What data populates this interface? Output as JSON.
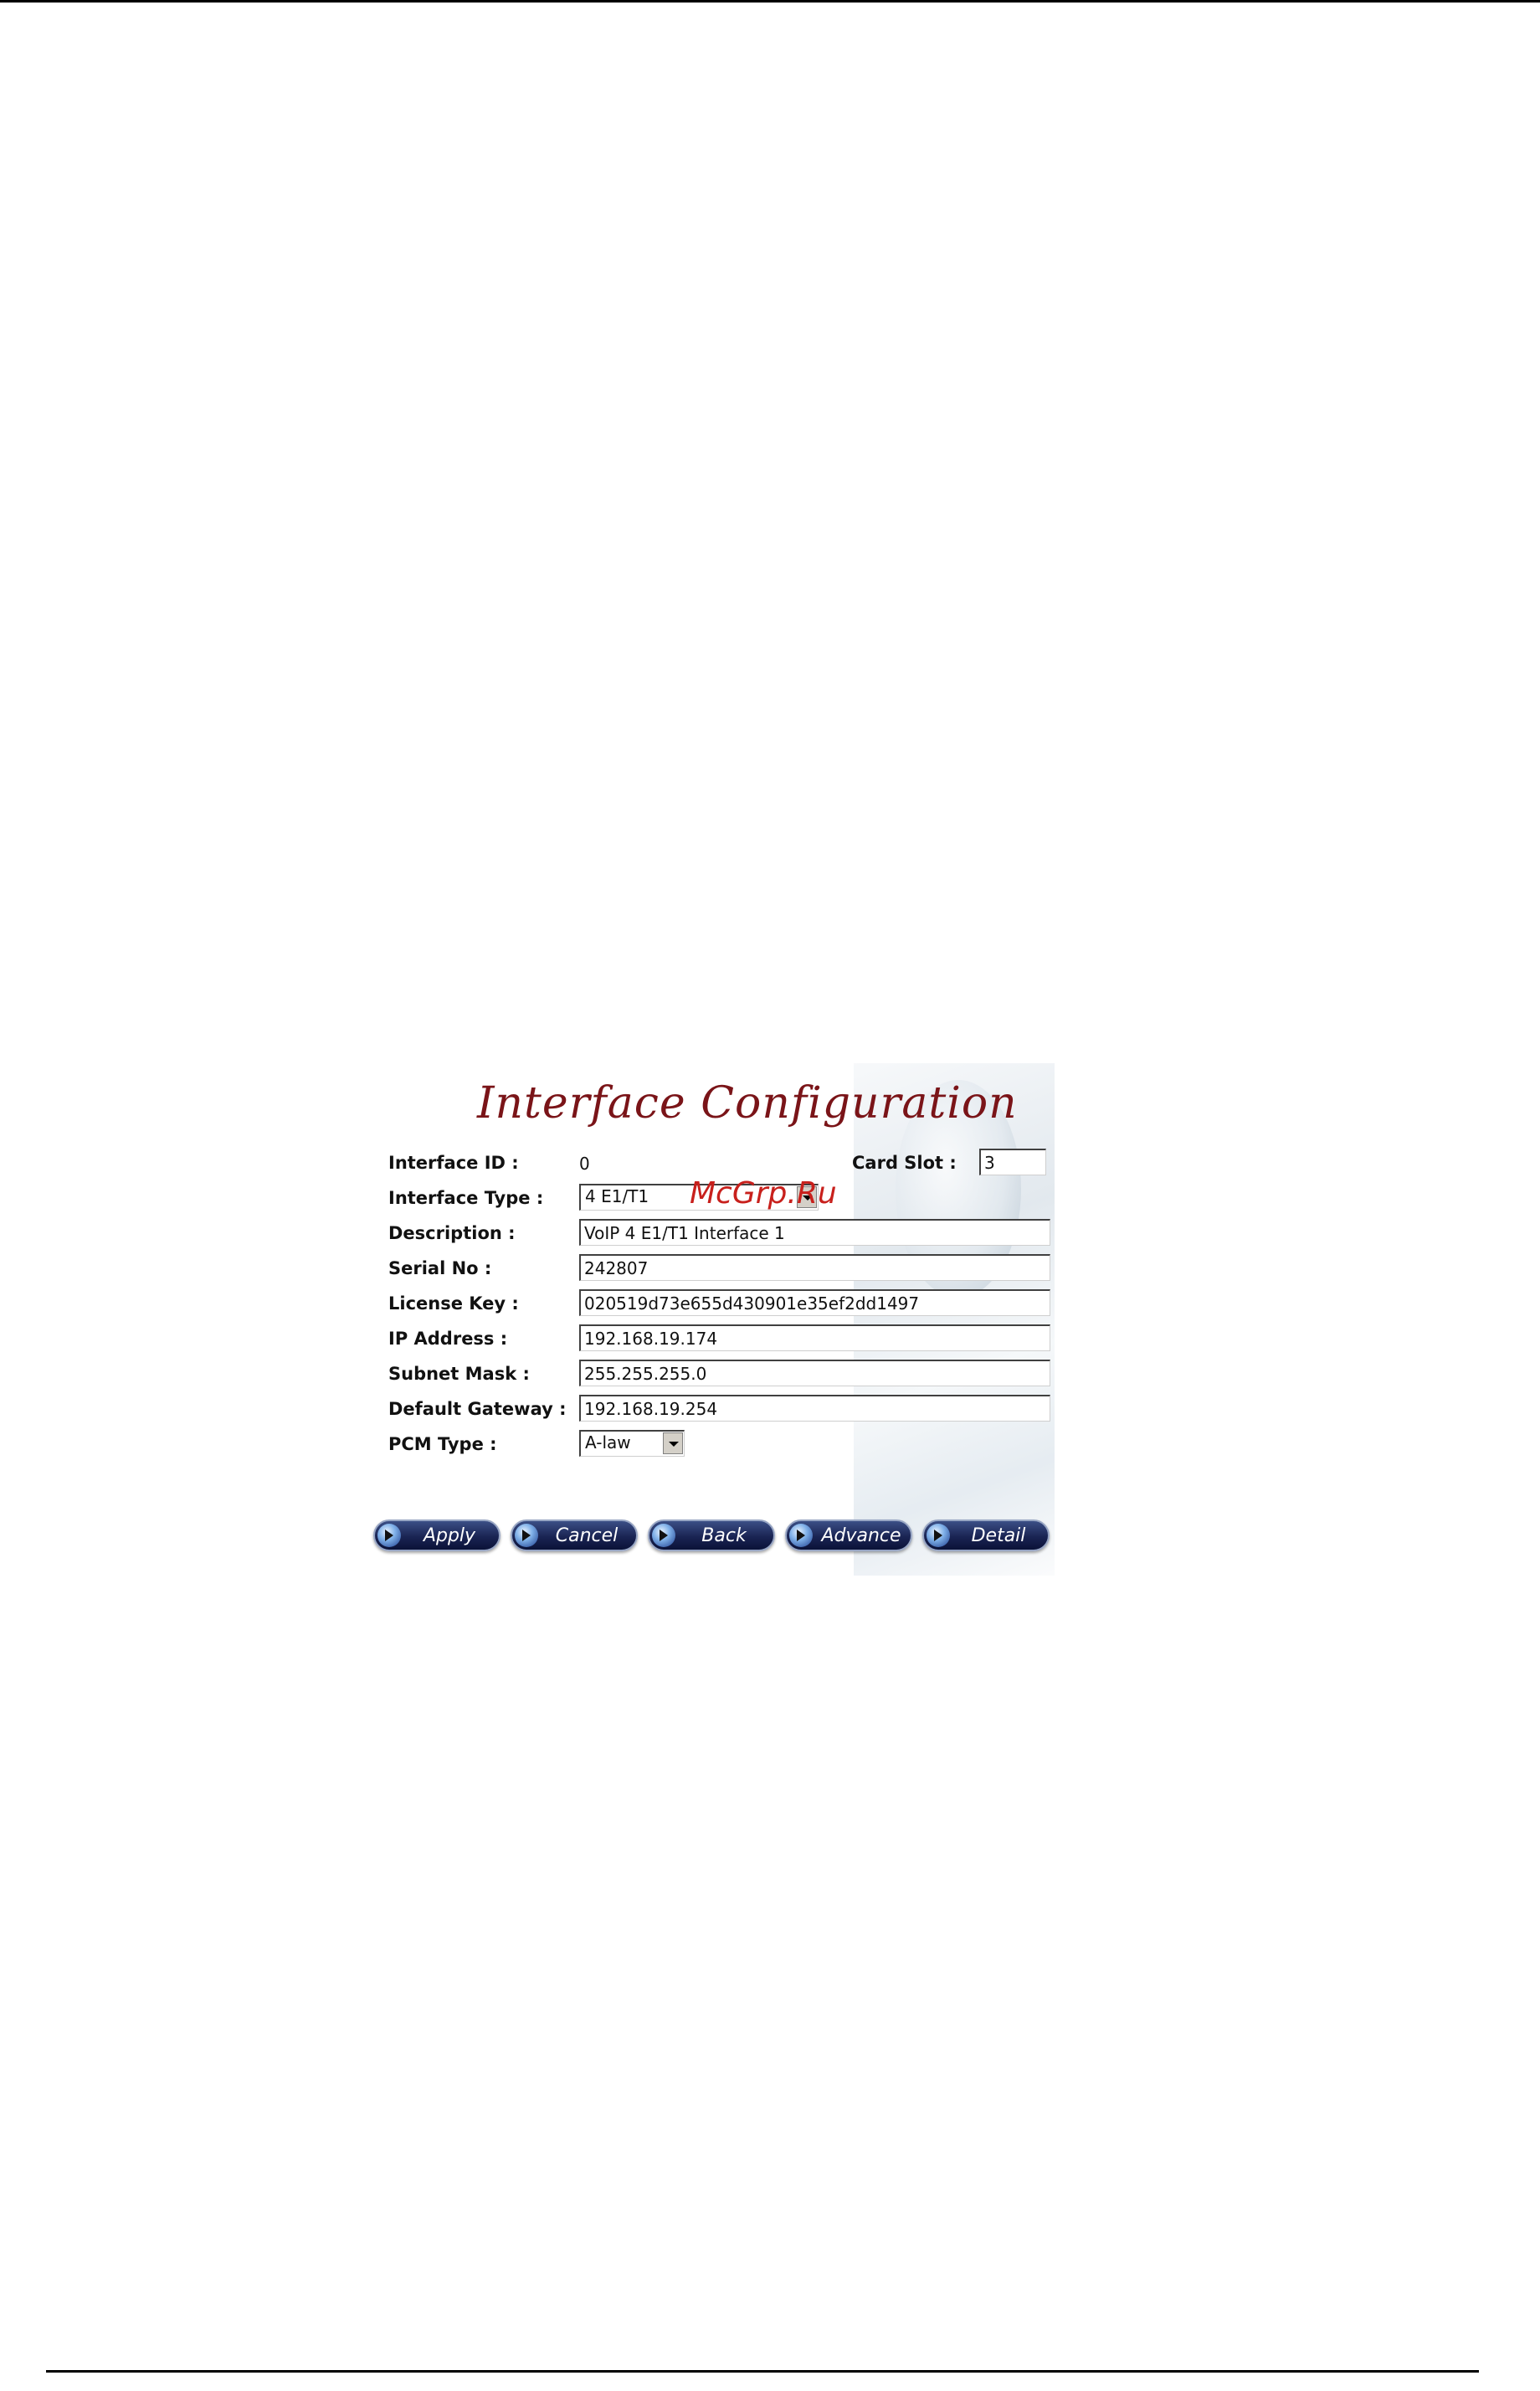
{
  "form": {
    "title": "Interface Configuration",
    "interface_id": {
      "label": "Interface ID :",
      "value": "0"
    },
    "card_slot": {
      "label": "Card Slot :",
      "value": "3"
    },
    "interface_type": {
      "label": "Interface Type :",
      "value": "4 E1/T1"
    },
    "description": {
      "label": "Description :",
      "value": "VoIP 4 E1/T1 Interface 1"
    },
    "serial_no": {
      "label": "Serial No :",
      "value": "242807"
    },
    "license_key": {
      "label": "License Key :",
      "value": "020519d73e655d430901e35ef2dd1497"
    },
    "ip_address": {
      "label": "IP Address :",
      "value": "192.168.19.174"
    },
    "subnet_mask": {
      "label": "Subnet Mask :",
      "value": "255.255.255.0"
    },
    "default_gateway": {
      "label": "Default Gateway :",
      "value": "192.168.19.254"
    },
    "pcm_type": {
      "label": "PCM Type :",
      "value": "A-law"
    }
  },
  "buttons": {
    "apply": "Apply",
    "cancel": "Cancel",
    "back": "Back",
    "advance": "Advance",
    "detail": "Detail"
  },
  "watermark": "McGrp.Ru",
  "colors": {
    "title": "#7a1418",
    "watermark": "#c8201c",
    "button": "#1a2453"
  }
}
